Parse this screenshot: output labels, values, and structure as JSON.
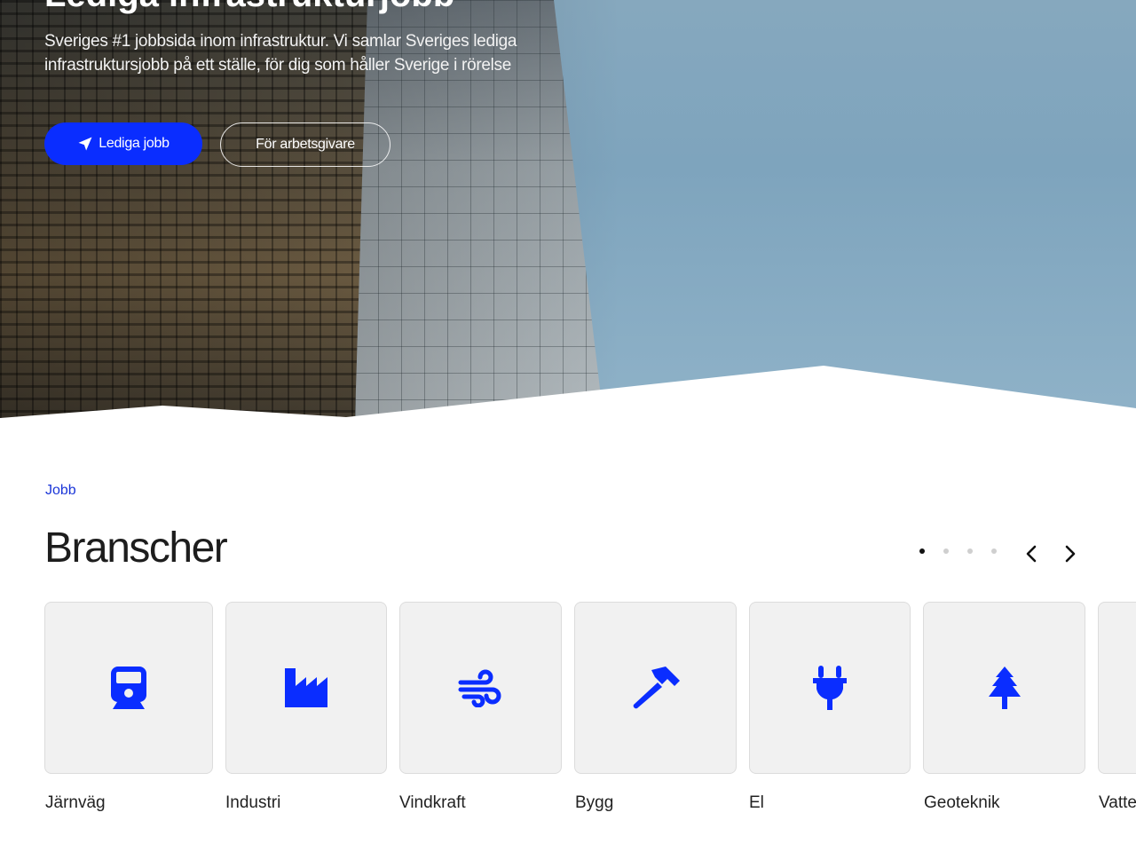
{
  "hero": {
    "title": "Lediga infrastrukturjobb",
    "description_line1": "Sveriges #1 jobbsida inom infrastruktur. Vi samlar Sveriges lediga",
    "description_line2": "infrastruktursjobb på ett ställe, för dig som håller Sverige i rörelse",
    "primary_button": "Lediga jobb",
    "secondary_button": "För arbetsgivare"
  },
  "section": {
    "eyebrow": "Jobb",
    "title": "Branscher",
    "active_page": 1,
    "page_count": 4
  },
  "industries": [
    {
      "label": "Järnväg",
      "icon": "train-icon"
    },
    {
      "label": "Industri",
      "icon": "factory-icon"
    },
    {
      "label": "Vindkraft",
      "icon": "wind-icon"
    },
    {
      "label": "Bygg",
      "icon": "hammer-icon"
    },
    {
      "label": "El",
      "icon": "plug-icon"
    },
    {
      "label": "Geoteknik",
      "icon": "tree-icon"
    },
    {
      "label": "Vatte",
      "icon": "water-icon"
    }
  ],
  "colors": {
    "accent": "#0a2dff",
    "card_bg": "#f1f1f1",
    "text": "#1d1d1d"
  }
}
